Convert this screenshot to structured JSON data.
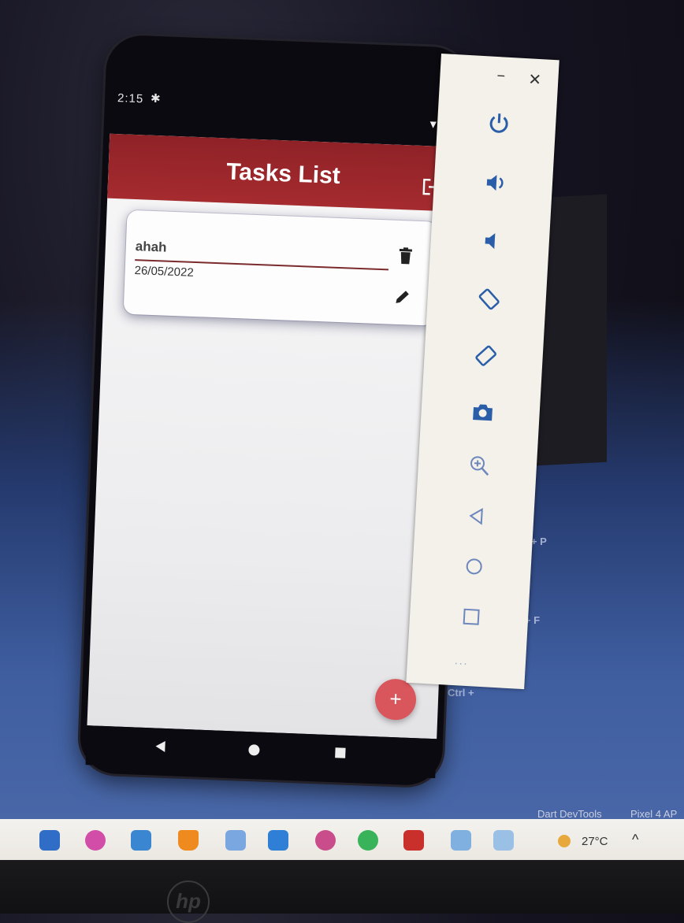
{
  "phone": {
    "status_time": "2:15",
    "appbar_title": "Tasks List",
    "task": {
      "title": "ahah",
      "date": "26/05/2022"
    },
    "fab_label": "+"
  },
  "emulator": {
    "minimize_label": "−",
    "close_label": "✕",
    "more_label": "..."
  },
  "background": {
    "shortcut_1": "ift + P",
    "shortcut_2": "ift + F",
    "shortcut_3": "Ctrl +"
  },
  "windows": {
    "title_1": "Dart DevTools",
    "title_2": "Pixel 4 AP"
  },
  "taskbar": {
    "temperature": "27°C",
    "chevron": "^"
  },
  "bezel": {
    "brand": "hp"
  },
  "colors": {
    "appbar": "#a52b2f",
    "fab": "#d9565c",
    "accent_icon": "#2a5ea8"
  }
}
